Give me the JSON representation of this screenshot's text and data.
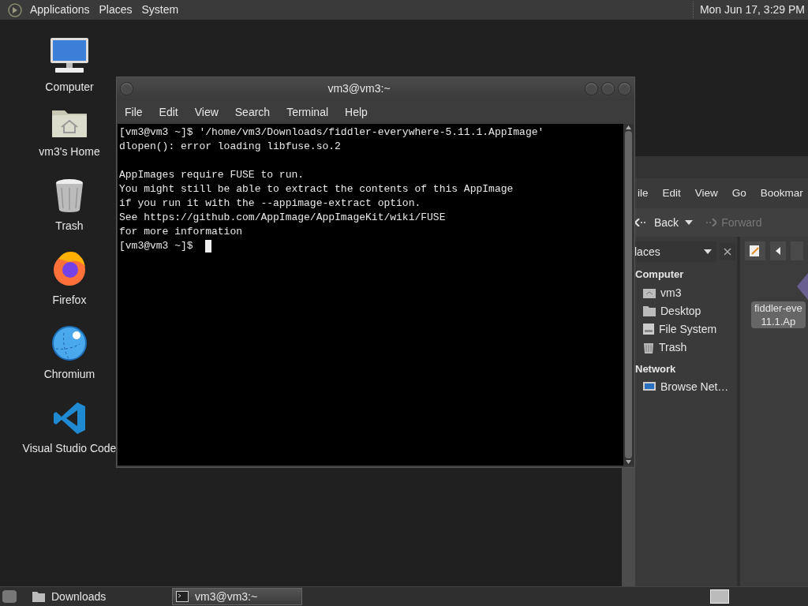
{
  "top_panel": {
    "menus": [
      "Applications",
      "Places",
      "System"
    ],
    "clock": "Mon Jun 17,  3:29 PM"
  },
  "desktop_icons": [
    {
      "label": "Computer",
      "kind": "computer"
    },
    {
      "label": "vm3's Home",
      "kind": "home"
    },
    {
      "label": "Trash",
      "kind": "trash"
    },
    {
      "label": "Firefox",
      "kind": "firefox"
    },
    {
      "label": "Chromium",
      "kind": "chromium"
    },
    {
      "label": "Visual Studio Code",
      "kind": "vscode"
    }
  ],
  "terminal": {
    "title": "vm3@vm3:~",
    "menu": [
      "File",
      "Edit",
      "View",
      "Search",
      "Terminal",
      "Help"
    ],
    "blocks": [
      [
        "[vm3@vm3 ~]$ '/home/vm3/Downloads/fiddler-everywhere-5.11.1.AppImage'",
        "dlopen(): error loading libfuse.so.2"
      ],
      [
        "AppImages require FUSE to run.",
        "You might still be able to extract the contents of this AppImage",
        "if you run it with the --appimage-extract option.",
        "See https://github.com/AppImage/AppImageKit/wiki/FUSE",
        "for more information"
      ]
    ],
    "prompt": "[vm3@vm3 ~]$"
  },
  "file_manager": {
    "menu": [
      "ile",
      "Edit",
      "View",
      "Go",
      "Bookmar"
    ],
    "back": {
      "label": "Back",
      "disabled": false
    },
    "forward": {
      "label": "Forward",
      "disabled": true
    },
    "places_selector": "laces",
    "sidebar": [
      {
        "heading": "Computer",
        "items": [
          {
            "label": "vm3",
            "kind": "home"
          },
          {
            "label": "Desktop",
            "kind": "folder"
          },
          {
            "label": "File System",
            "kind": "drive"
          },
          {
            "label": "Trash",
            "kind": "trash"
          }
        ]
      },
      {
        "heading": "Network",
        "items": [
          {
            "label": "Browse Net…",
            "kind": "network"
          }
        ]
      }
    ],
    "files": [
      {
        "label_lines": [
          "fiddler-eve",
          "11.1.Ap"
        ],
        "selected": true
      }
    ]
  },
  "taskbar": {
    "items": [
      {
        "label": "Downloads",
        "kind": "folder",
        "selected": false
      },
      {
        "label": "vm3@vm3:~",
        "kind": "terminal",
        "selected": true
      }
    ]
  }
}
